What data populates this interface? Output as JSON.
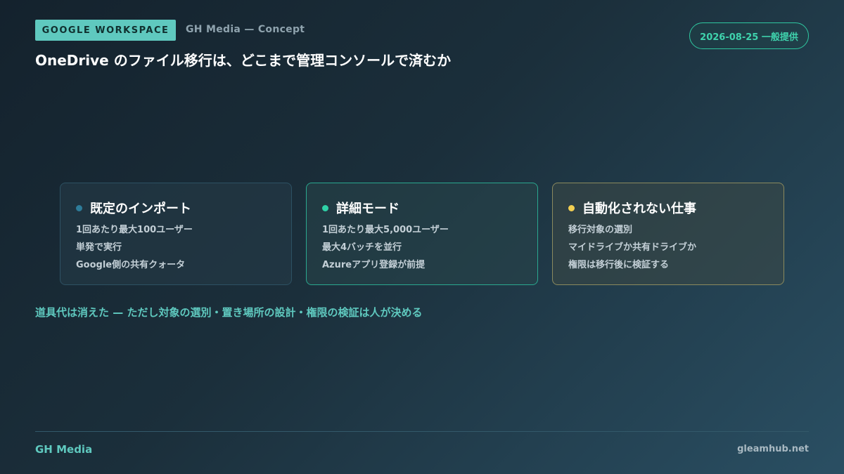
{
  "header": {
    "tag": "GOOGLE WORKSPACE",
    "concept": "GH Media — Concept",
    "date_badge": "2026-08-25 一般提供",
    "title": "OneDrive のファイル移行は、どこまで管理コンソールで済むか"
  },
  "cards": [
    {
      "title": "既定のインポート",
      "dot_color": "#2e7c99",
      "lines": [
        "1回あたり最大100ユーザー",
        "単発で実行",
        "Google側の共有クォータ"
      ]
    },
    {
      "title": "詳細モード",
      "dot_color": "#2fd1a7",
      "lines": [
        "1回あたり最大5,000ユーザー",
        "最大4バッチを並行",
        "Azureアプリ登録が前提"
      ]
    },
    {
      "title": "自動化されない仕事",
      "dot_color": "#f2cf52",
      "lines": [
        "移行対象の選別",
        "マイドライブか共有ドライブか",
        "権限は移行後に検証する"
      ]
    }
  ],
  "summary": "道具代は消えた — ただし対象の選別・置き場所の設計・権限の検証は人が決める",
  "footer": {
    "brand": "GH Media",
    "site": "gleamhub.net"
  },
  "colors": {
    "accent": "#5fc9bf",
    "date_badge": "#2fc7a0"
  }
}
